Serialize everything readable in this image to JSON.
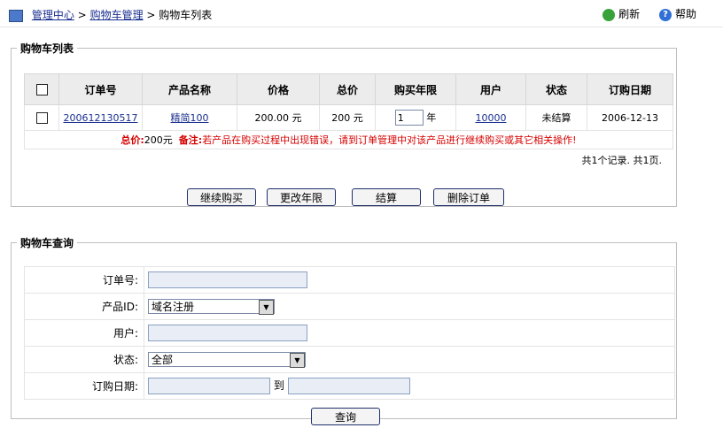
{
  "breadcrumb": {
    "home": "管理中心",
    "sep": ">",
    "section": "购物车管理",
    "current": "购物车列表"
  },
  "top_actions": {
    "refresh": "刷新",
    "help": "帮助"
  },
  "cart_list": {
    "legend": "购物车列表",
    "columns": [
      "订单号",
      "产品名称",
      "价格",
      "总价",
      "购买年限",
      "用户",
      "状态",
      "订购日期"
    ],
    "rows": [
      {
        "order_no": "200612130517",
        "product": "精简100",
        "price": "200.00 元",
        "total": "200 元",
        "years": "1",
        "year_unit": "年",
        "user": "10000",
        "status": "未结算",
        "date": "2006-12-13"
      }
    ],
    "total_label": "总价:",
    "total_value": "200元",
    "note_label": "备注:",
    "note_text": "若产品在购买过程中出现错误，请到订单管理中对该产品进行继续购买或其它相关操作!",
    "summary": "共1个记录. 共1页.",
    "buttons": {
      "continue": "继续购买",
      "change_years": "更改年限",
      "checkout": "结算",
      "delete": "删除订单"
    }
  },
  "cart_query": {
    "legend": "购物车查询",
    "order_no_label": "订单号:",
    "product_id_label": "产品ID:",
    "product_id_value": "域名注册",
    "user_label": "用户:",
    "status_label": "状态:",
    "status_value": "全部",
    "date_label": "订购日期:",
    "date_to": "到",
    "query_button": "查询"
  }
}
